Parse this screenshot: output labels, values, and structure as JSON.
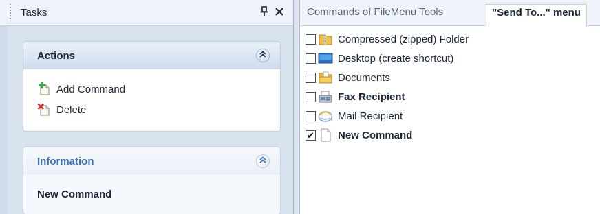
{
  "tasks_panel": {
    "title": "Tasks",
    "pin_glyph": "Ԅ",
    "close_glyph": "✕",
    "actions_group": {
      "title": "Actions",
      "collapse_glyph": "»",
      "items": [
        {
          "label": "Add Command",
          "icon": "add-command-icon"
        },
        {
          "label": "Delete",
          "icon": "delete-icon"
        }
      ]
    },
    "information_group": {
      "title": "Information",
      "collapse_glyph": "»",
      "selected_name": "New Command"
    }
  },
  "tabs": [
    {
      "label": "Commands of FileMenu Tools",
      "active": false
    },
    {
      "label": "\"Send To...\" menu",
      "active": true
    }
  ],
  "send_to_items": [
    {
      "label": "Compressed (zipped) Folder",
      "checked": false,
      "bold": false,
      "icon": "zip-folder-icon"
    },
    {
      "label": "Desktop (create shortcut)",
      "checked": false,
      "bold": false,
      "icon": "desktop-icon"
    },
    {
      "label": "Documents",
      "checked": false,
      "bold": false,
      "icon": "documents-folder-icon"
    },
    {
      "label": "Fax Recipient",
      "checked": false,
      "bold": true,
      "icon": "fax-icon"
    },
    {
      "label": "Mail Recipient",
      "checked": false,
      "bold": false,
      "icon": "mail-icon"
    },
    {
      "label": "New Command",
      "checked": true,
      "bold": true,
      "icon": "blank-document-icon"
    }
  ],
  "colors": {
    "panel_background": "#d8e2ef",
    "information_title": "#3a74b7"
  }
}
